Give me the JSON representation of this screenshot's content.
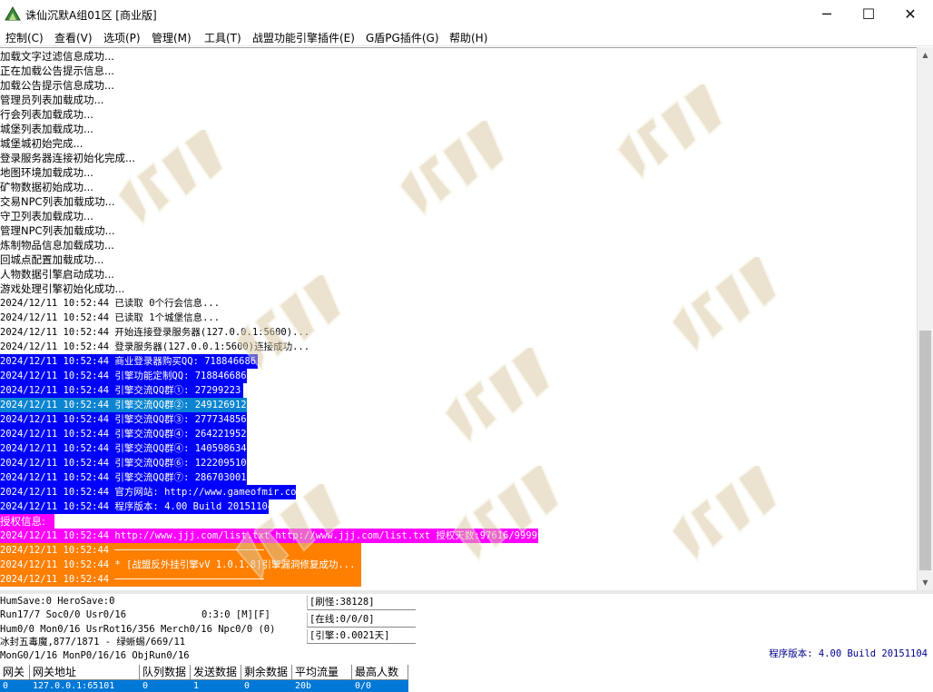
{
  "window": {
    "title": "诛仙沉默A组01区 [商业版]",
    "minimize_glyph": "─",
    "maximize_glyph": "☐",
    "close_glyph": "✕"
  },
  "menu": [
    "控制(C)",
    "查看(V)",
    "选项(P)",
    "管理(M)",
    "工具(T)",
    "战盟功能引擎插件(E)",
    "G盾PG插件(G)",
    "帮助(H)"
  ],
  "colors": {
    "blue_highlight": "#0000ff",
    "teal_highlight": "#0a84d2",
    "magenta_highlight": "#ff00ff",
    "orange_highlight": "#ff7f00",
    "selected_row": "#0078d7"
  },
  "log_lines": [
    {
      "text": "加载文字过滤信息成功...",
      "style": "plain"
    },
    {
      "text": "正在加载公告提示信息...",
      "style": "plain"
    },
    {
      "text": "加载公告提示信息成功...",
      "style": "plain"
    },
    {
      "text": "管理员列表加载成功...",
      "style": "plain"
    },
    {
      "text": "行会列表加载成功...",
      "style": "plain"
    },
    {
      "text": "城堡列表加载成功...",
      "style": "plain"
    },
    {
      "text": "城堡城初始完成...",
      "style": "plain"
    },
    {
      "text": "登录服务器连接初始化完成...",
      "style": "plain"
    },
    {
      "text": "地图环境加载成功...",
      "style": "plain"
    },
    {
      "text": "矿物数据初始成功...",
      "style": "plain"
    },
    {
      "text": "交易NPC列表加载成功...",
      "style": "plain"
    },
    {
      "text": "守卫列表加载成功...",
      "style": "plain"
    },
    {
      "text": "管理NPC列表加载成功...",
      "style": "plain"
    },
    {
      "text": "炼制物品信息加载成功...",
      "style": "plain"
    },
    {
      "text": "回城点配置加载成功...",
      "style": "plain"
    },
    {
      "text": "人物数据引擎启动成功...",
      "style": "plain"
    },
    {
      "text": "游戏处理引擎初始化成功...",
      "style": "plain"
    },
    {
      "text": "2024/12/11 10:52:44 已读取 0个行会信息...",
      "style": "plain"
    },
    {
      "text": "2024/12/11 10:52:44 已读取 1个城堡信息...",
      "style": "plain"
    },
    {
      "text": "2024/12/11 10:52:44 开始连接登录服务器(127.0.0.1:5600)...",
      "style": "plain"
    },
    {
      "text": "2024/12/11 10:52:44 登录服务器(127.0.0.1:5600)连接成功...",
      "style": "plain"
    },
    {
      "text": "2024/12/11 10:52:44 商业登录器购买QQ: 718846686",
      "style": "blue"
    },
    {
      "text": "2024/12/11 10:52:44 引擎功能定制QQ: 718846686",
      "style": "blue"
    },
    {
      "text": "2024/12/11 10:52:44 引擎交流QQ群①: 27299223",
      "style": "blue"
    },
    {
      "text": "2024/12/11 10:52:44 引擎交流QQ群②: 249126912",
      "style": "teal"
    },
    {
      "text": "2024/12/11 10:52:44 引擎交流QQ群③: 277734856",
      "style": "blue"
    },
    {
      "text": "2024/12/11 10:52:44 引擎交流QQ群④: 264221952",
      "style": "blue"
    },
    {
      "text": "2024/12/11 10:52:44 引擎交流QQ群④: 140598634",
      "style": "blue"
    },
    {
      "text": "2024/12/11 10:52:44 引擎交流QQ群⑥: 122209510",
      "style": "blue"
    },
    {
      "text": "2024/12/11 10:52:44 引擎交流QQ群⑦: 286703001",
      "style": "blue"
    },
    {
      "text": "2024/12/11 10:52:44 官方网站: http://www.gameofmir.com",
      "style": "blue"
    },
    {
      "text": "2024/12/11 10:52:44 程序版本: 4.00 Build 20151104",
      "style": "blue"
    },
    {
      "text": "授权信息:",
      "style": "magenta"
    },
    {
      "text": "2024/12/11 10:52:44 http://www.jjj.com/list.txt http://www.jjj.com/list.txt 授权天数:97616/99999",
      "style": "magenta"
    },
    {
      "text": "2024/12/11 10:52:44 ──────────────────────────",
      "style": "orange"
    },
    {
      "text": "2024/12/11 10:52:44 * [战盟反外挂引擎vV 1.0.1.8]引擎漏洞修复成功...",
      "style": "orange"
    },
    {
      "text": "2024/12/11 10:52:44 ──────────────────────────",
      "style": "orange"
    }
  ],
  "status": {
    "line1": "HumSave:0 HeroSave:0",
    "line2_left": "Run17/7 Soc0/0 Usr0/16",
    "line2_right": "0:3:0 [M][F]",
    "line3": "Hum0/0 Mon0/16 UsrRot16/356 Merch0/16 Npc0/0 (0)",
    "line4": "冰封五毒魔,877/1871 - 绿蜥蜴/669/11",
    "line5": "MonG0/1/16 MonP0/16/16 ObjRun0/16",
    "refresh": "[刷怪:38128]",
    "online": "[在线:0/0/0]",
    "engine": "[引擎:0.0021天]",
    "version": "程序版本: 4.00 Build 20151104"
  },
  "gate_table": {
    "headers": [
      "网关",
      "网关地址",
      "队列数据",
      "发送数据",
      "剩余数据",
      "平均流量",
      "最高人数"
    ],
    "rows": [
      [
        "0",
        "127.0.0.1:65101",
        "0",
        "1",
        "0",
        "20b",
        "0/0"
      ]
    ]
  }
}
